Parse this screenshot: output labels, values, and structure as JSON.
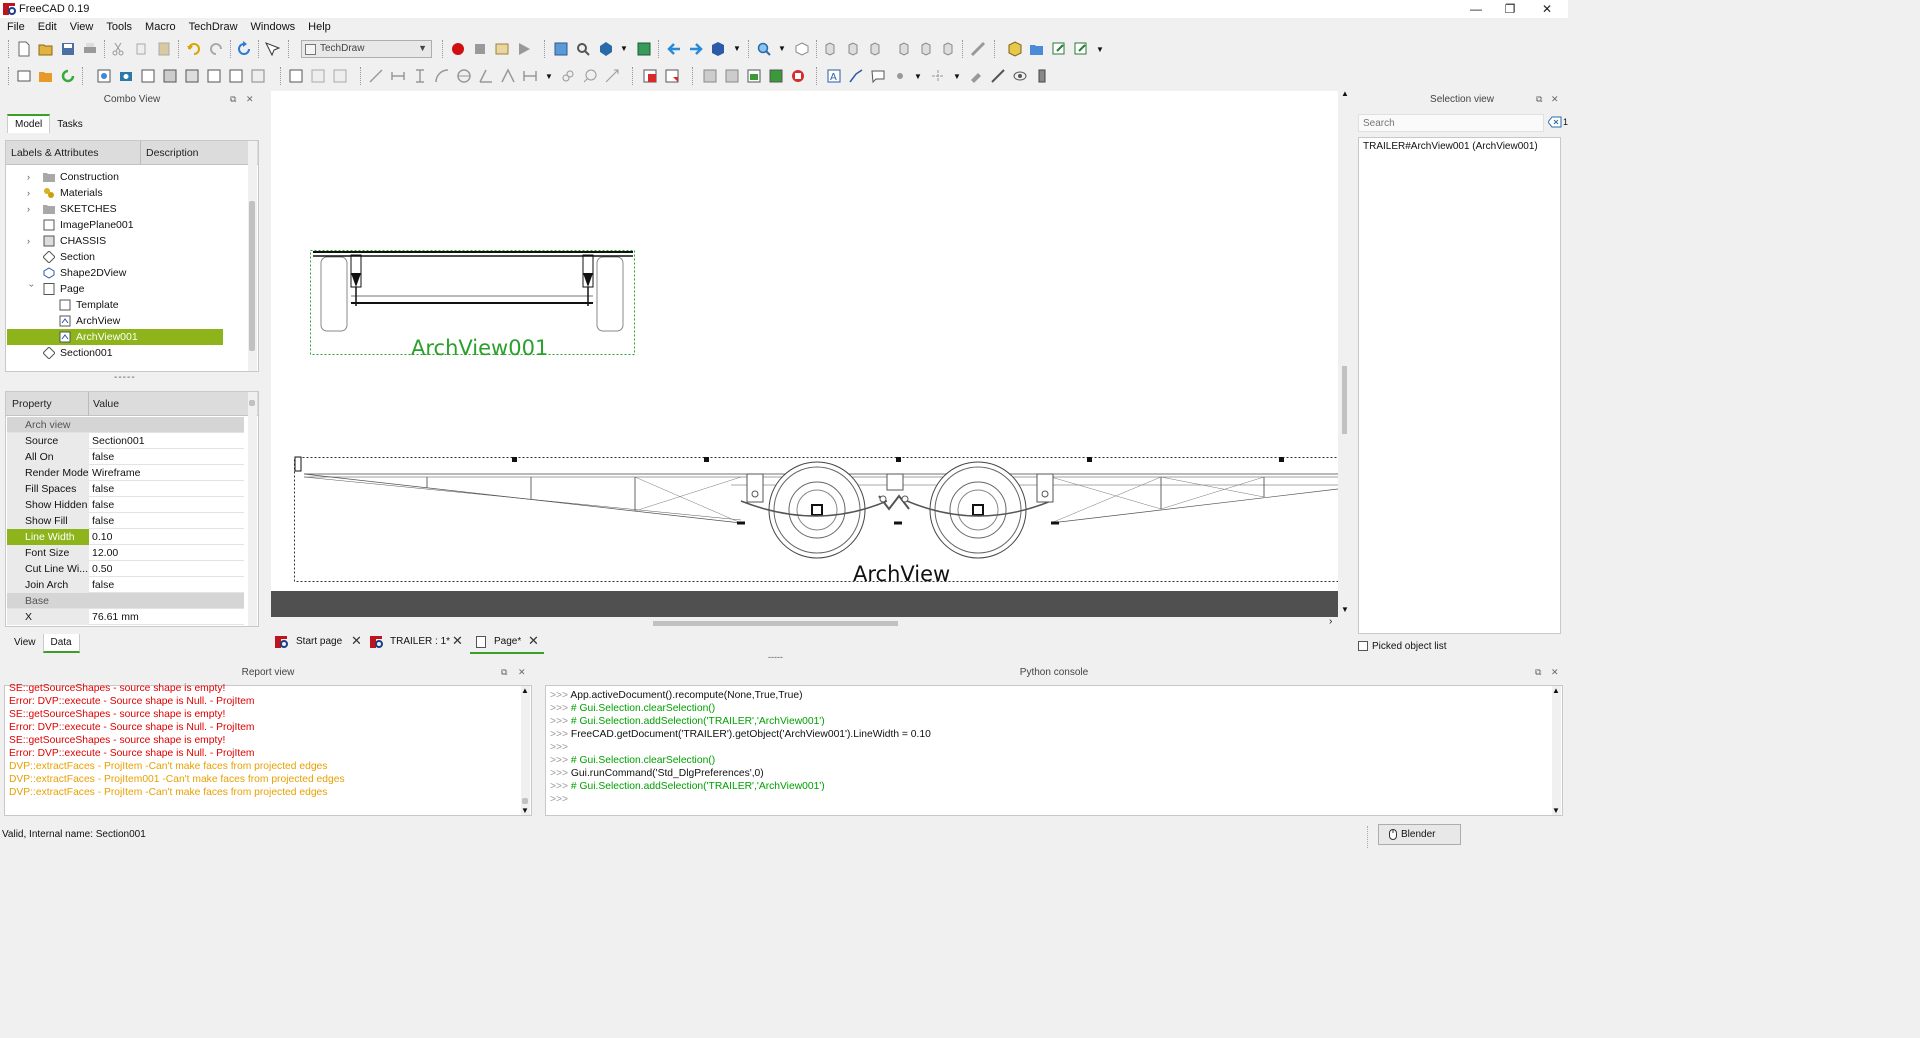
{
  "window": {
    "title": "FreeCAD 0.19",
    "minimize": "—",
    "restore": "❐",
    "close": "✕"
  },
  "menu": [
    "File",
    "Edit",
    "View",
    "Tools",
    "Macro",
    "TechDraw",
    "Windows",
    "Help"
  ],
  "toolbar": {
    "workbench": "TechDraw"
  },
  "combo_view": {
    "title": "Combo View",
    "tabs": [
      "Model",
      "Tasks"
    ],
    "tree_headers": [
      "Labels & Attributes",
      "Description"
    ],
    "tree": [
      {
        "label": "Construction",
        "icon": "folder-icon"
      },
      {
        "label": "Materials",
        "icon": "materials-icon"
      },
      {
        "label": "SKETCHES",
        "icon": "folder-icon"
      },
      {
        "label": "ImagePlane001",
        "icon": "image-plane-icon"
      },
      {
        "label": "CHASSIS",
        "icon": "group-icon"
      },
      {
        "label": "Section",
        "icon": "section-plane-icon"
      },
      {
        "label": "Shape2DView",
        "icon": "shape2dview-icon"
      },
      {
        "label": "Page",
        "icon": "page-icon"
      },
      {
        "label": "Template",
        "icon": "template-icon"
      },
      {
        "label": "ArchView",
        "icon": "archview-icon"
      },
      {
        "label": "ArchView001",
        "icon": "archview-icon"
      },
      {
        "label": "Section001",
        "icon": "section-plane-icon"
      }
    ],
    "splitter": "-----",
    "prop_headers": [
      "Property",
      "Value"
    ],
    "properties": [
      {
        "group": "Arch view"
      },
      {
        "name": "Source",
        "value": "Section001"
      },
      {
        "name": "All On",
        "value": "false"
      },
      {
        "name": "Render Mode",
        "value": "Wireframe"
      },
      {
        "name": "Fill Spaces",
        "value": "false"
      },
      {
        "name": "Show Hidden",
        "value": "false"
      },
      {
        "name": "Show Fill",
        "value": "false"
      },
      {
        "name": "Line Width",
        "value": "0.10"
      },
      {
        "name": "Font Size",
        "value": "12.00"
      },
      {
        "name": "Cut Line Wi...",
        "value": "0.50"
      },
      {
        "name": "Join Arch",
        "value": "false"
      },
      {
        "group": "Base"
      },
      {
        "name": "X",
        "value": "76.61 mm"
      }
    ],
    "bottom_tabs": [
      "View",
      "Data"
    ]
  },
  "drawing": {
    "label_top": "ArchView001",
    "label_bottom": "ArchView"
  },
  "doc_tabs": [
    "Start page",
    "TRAILER : 1*",
    "Page*"
  ],
  "report_view": {
    "title": "Report view",
    "lines": [
      {
        "t": "SE::getSourceShapes - source shape is empty!",
        "c": "err"
      },
      {
        "t": "Error: DVP::execute - Source shape is Null. - ProjItem",
        "c": "err"
      },
      {
        "t": "SE::getSourceShapes - source shape is empty!",
        "c": "err"
      },
      {
        "t": "Error: DVP::execute - Source shape is Null. - ProjItem",
        "c": "err"
      },
      {
        "t": "SE::getSourceShapes - source shape is empty!",
        "c": "err"
      },
      {
        "t": "Error: DVP::execute - Source shape is Null. - ProjItem",
        "c": "err"
      },
      {
        "t": "DVP::extractFaces - ProjItem -Can't make faces from projected edges",
        "c": "warn"
      },
      {
        "t": "DVP::extractFaces - ProjItem001 -Can't make faces from projected edges",
        "c": "warn"
      },
      {
        "t": "DVP::extractFaces - ProjItem -Can't make faces from projected edges",
        "c": "warn"
      }
    ]
  },
  "python_console": {
    "title": "Python console",
    "prompt": ">>>",
    "lines": [
      "App.activeDocument().recompute(None,True,True)",
      "# Gui.Selection.clearSelection()",
      "# Gui.Selection.addSelection('TRAILER','ArchView001')",
      "FreeCAD.getDocument('TRAILER').getObject('ArchView001').LineWidth = 0.10",
      "",
      "# Gui.Selection.clearSelection()",
      "Gui.runCommand('Std_DlgPreferences',0)",
      "# Gui.Selection.addSelection('TRAILER','ArchView001')",
      ""
    ]
  },
  "selection_view": {
    "title": "Selection view",
    "search_placeholder": "Search",
    "count": "1",
    "items": [
      "TRAILER#ArchView001 (ArchView001)"
    ],
    "picked_label": "Picked object list"
  },
  "statusbar": {
    "text": "Valid, Internal name: Section001",
    "nav_style": "Blender"
  },
  "colors": {
    "selection": "#8db51b",
    "error": "#e00000",
    "warning": "#e8a000",
    "view_green": "#2ca02c"
  }
}
